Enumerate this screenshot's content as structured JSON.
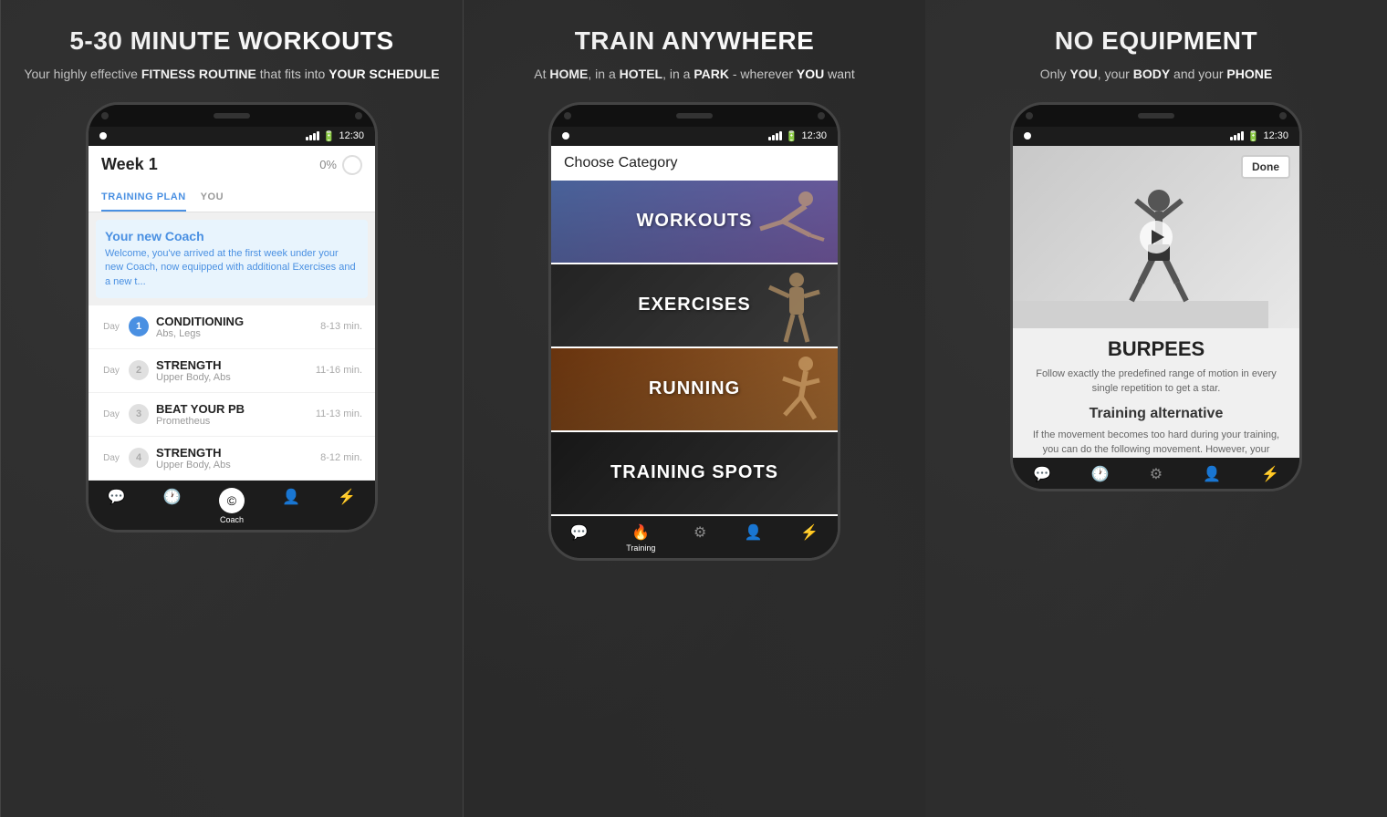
{
  "panels": [
    {
      "id": "panel1",
      "title": "5-30 MINUTE WORKOUTS",
      "subtitle_html": "Your highly effective <b>FITNESS ROUTINE</b> that fits into <b>YOUR SCHEDULE</b>",
      "phone": {
        "time": "12:30",
        "header_title": "Week 1",
        "progress": "0%",
        "tabs": [
          {
            "label": "TRAINING PLAN",
            "active": true
          },
          {
            "label": "YOU",
            "active": false
          }
        ],
        "coach_card": {
          "title": "Your new Coach",
          "text": "Welcome, you've arrived at the first week under your new Coach, now equipped with additional Exercises and a new t..."
        },
        "workouts": [
          {
            "day": "Day",
            "number": "1",
            "active": true,
            "name": "CONDITIONING",
            "type": "Abs, Legs",
            "duration": "8-13 min."
          },
          {
            "day": "Day",
            "number": "2",
            "active": false,
            "name": "STRENGTH",
            "type": "Upper Body, Abs",
            "duration": "11-16 min."
          },
          {
            "day": "Day",
            "number": "3",
            "active": false,
            "name": "BEAT YOUR PB",
            "type": "Prometheus",
            "duration": "11-13 min."
          },
          {
            "day": "Day",
            "number": "4",
            "active": false,
            "name": "STRENGTH",
            "type": "Upper Body, Abs",
            "duration": "8-12 min."
          }
        ],
        "nav": [
          {
            "icon": "💬",
            "label": "",
            "active": false
          },
          {
            "icon": "🕐",
            "label": "",
            "active": false
          },
          {
            "icon": "©",
            "label": "Coach",
            "active": true
          },
          {
            "icon": "👤",
            "label": "",
            "active": false
          },
          {
            "icon": "⚡",
            "label": "",
            "active": false
          }
        ]
      }
    },
    {
      "id": "panel2",
      "title": "TRAIN ANYWHERE",
      "subtitle_html": "At <b>HOME</b>, in a <b>HOTEL</b>, in a <b>PARK</b> - wherever <b>YOU</b> want",
      "phone": {
        "time": "12:30",
        "header_title": "Choose Category",
        "categories": [
          {
            "label": "WORKOUTS",
            "bg": "workouts"
          },
          {
            "label": "EXERCISES",
            "bg": "exercises"
          },
          {
            "label": "RUNNING",
            "bg": "running"
          },
          {
            "label": "TRAINING SPOTS",
            "bg": "spots"
          }
        ],
        "nav": [
          {
            "icon": "💬",
            "label": "",
            "active": false
          },
          {
            "icon": "🔥",
            "label": "Training",
            "active": true
          },
          {
            "icon": "⚙",
            "label": "",
            "active": false
          },
          {
            "icon": "👤",
            "label": "",
            "active": false
          },
          {
            "icon": "⚡",
            "label": "",
            "active": false
          }
        ]
      }
    },
    {
      "id": "panel3",
      "title": "NO EQUIPMENT",
      "subtitle_html": "Only <b>YOU</b>, your <b>BODY</b> and your <b>PHONE</b>",
      "phone": {
        "time": "12:30",
        "done_button": "Done",
        "play_button": true,
        "exercise_name": "BURPEES",
        "exercise_desc": "Follow exactly the predefined range of motion in every single repetition to get a star.",
        "alt_title": "Training alternative",
        "alt_desc": "If the movement becomes too hard during your training, you can do the following movement. However, your",
        "nav": [
          {
            "icon": "💬",
            "label": "",
            "active": false
          },
          {
            "icon": "🕐",
            "label": "",
            "active": false
          },
          {
            "icon": "⚙",
            "label": "",
            "active": false
          },
          {
            "icon": "👤",
            "label": "",
            "active": false
          },
          {
            "icon": "⚡",
            "label": "",
            "active": false
          }
        ]
      }
    }
  ]
}
